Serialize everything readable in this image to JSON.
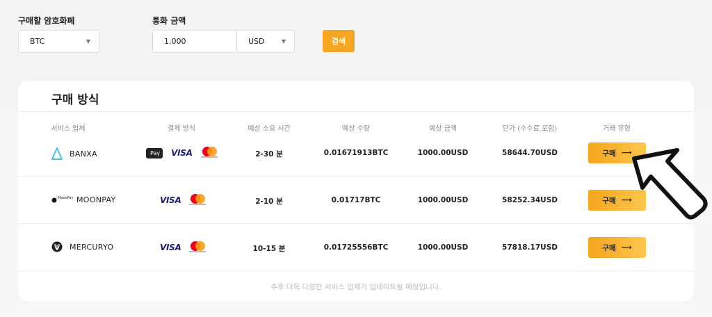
{
  "form": {
    "crypto_label": "구매할 암호화폐",
    "crypto_value": "BTC",
    "currency_label": "통화 금액",
    "amount_value": "1,000",
    "currency_value": "USD",
    "search_label": "검색"
  },
  "card": {
    "title": "구매 방식",
    "headers": [
      "서비스 업체",
      "결제 방식",
      "예상 소요 시간",
      "예상 수량",
      "예상 금액",
      "단가 (수수료 포함)",
      "거래 유형"
    ],
    "rows": [
      {
        "vendor": "BANXA",
        "time": "2-30 분",
        "qty": "0.01671913BTC",
        "amount": "1000.00USD",
        "price": "58644.70USD",
        "buy": "구매",
        "apple_pay": "Pay",
        "visa": "VISA"
      },
      {
        "vendor": "MOONPAY",
        "vendor_logo_text": "MoonPay",
        "time": "2-10 분",
        "qty": "0.01717BTC",
        "amount": "1000.00USD",
        "price": "58252.34USD",
        "buy": "구매",
        "visa": "VISA"
      },
      {
        "vendor": "MERCURYO",
        "time": "10-15 분",
        "qty": "0.01725556BTC",
        "amount": "1000.00USD",
        "price": "57818.17USD",
        "buy": "구매",
        "visa": "VISA"
      }
    ],
    "footer": "추후 더욱 다양한 서비스 업체가 업데이트될 예정입니다."
  },
  "colors": {
    "accent": "#f5a623",
    "button_gradient_start": "#f6a51f",
    "button_gradient_end": "#fbc64d"
  },
  "icons": {
    "caret": "caret-down-icon",
    "buy_arrow": "arrow-right-icon",
    "pointer": "cursor-arrow-icon"
  }
}
